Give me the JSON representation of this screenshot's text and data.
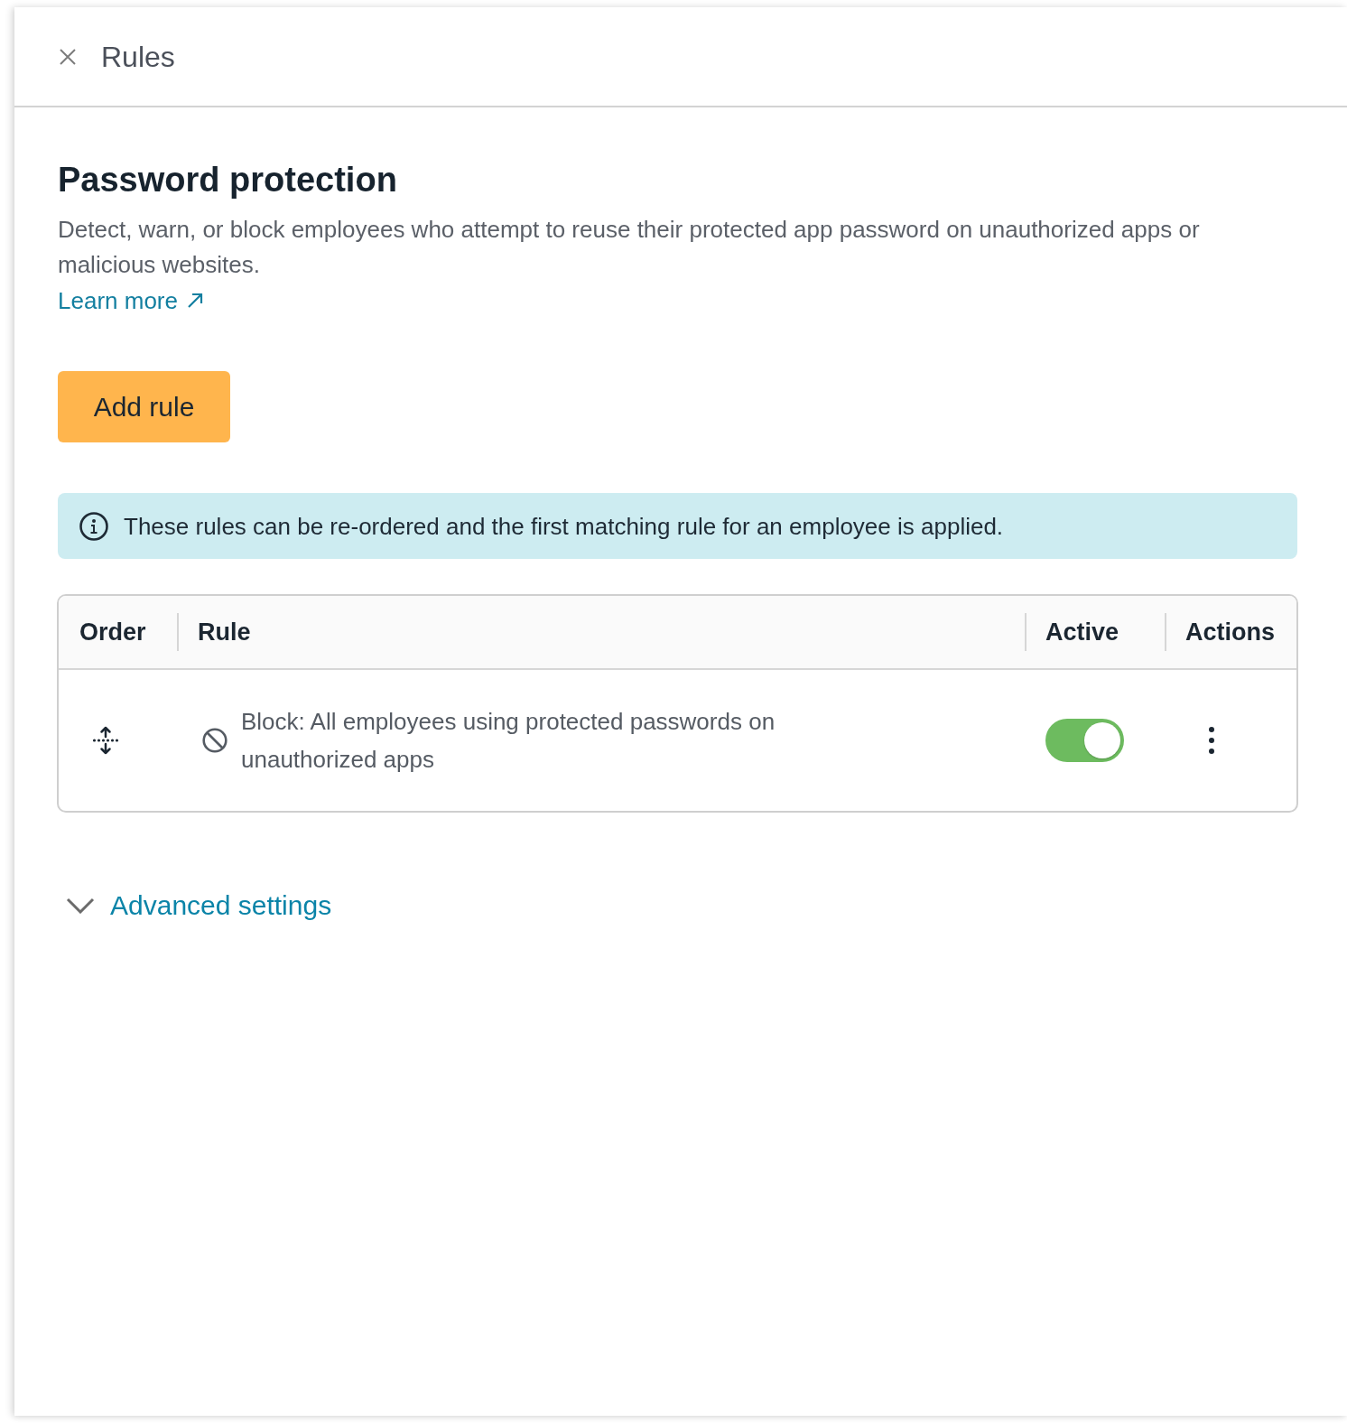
{
  "panel": {
    "title": "Rules"
  },
  "section": {
    "heading": "Password protection",
    "description": "Detect, warn, or block employees who attempt to reuse their protected app password on unauthorized apps or malicious websites.",
    "learn_more": "Learn more"
  },
  "add_rule_button": "Add rule",
  "info_banner": "These rules can be re-ordered and the first matching rule for an employee is applied.",
  "table": {
    "columns": [
      "Order",
      "Rule",
      "Active",
      "Actions"
    ],
    "rows": [
      {
        "kind": "block",
        "rule": "Block: All employees using protected passwords on unauthorized apps",
        "active": true
      }
    ]
  },
  "advanced_settings": {
    "label": "Advanced settings",
    "expanded": false
  }
}
